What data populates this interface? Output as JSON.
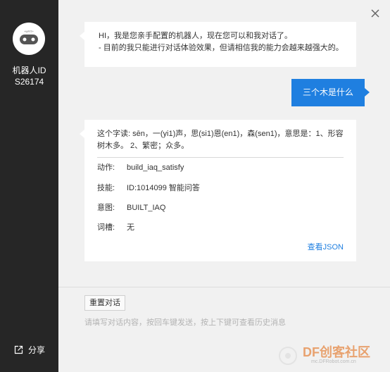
{
  "sidebar": {
    "avatar_badge": "+UFIT+",
    "robot_id_label": "机器人ID",
    "robot_id_value": "S26174",
    "share_label": "分享"
  },
  "chat": {
    "greeting_line1": "HI，我是您亲手配置的机器人，现在您可以和我对话了。",
    "greeting_line2": "- 目前的我只能进行对话体验效果，但请相信我的能力会越来越强大的。",
    "user_message": "三个木是什么",
    "answer_text": "这个字读: sēn，一(yi1)声，思(si1)恩(en1)，森(sen1)，意思是：1、形容树木多。 2、繁密；众多。",
    "details": [
      {
        "key": "动作:",
        "value": "build_iaq_satisfy"
      },
      {
        "key": "技能:",
        "value": "ID:1014099  智能问答"
      },
      {
        "key": "意图:",
        "value": "BUILT_IAQ"
      },
      {
        "key": "词槽:",
        "value": "无"
      }
    ],
    "json_link": "查看JSON"
  },
  "input_area": {
    "reset_button": "重置对话",
    "placeholder": "请填写对话内容，按回车键发送，按上下键可查看历史消息"
  },
  "watermark": {
    "brand_prefix": "DF",
    "brand_name": "创客社区",
    "url": "mc.DFRobot.com.cn"
  },
  "colors": {
    "sidebar_bg": "#262626",
    "accent_blue": "#1f7fe0",
    "page_bg": "#f1f1f1"
  }
}
